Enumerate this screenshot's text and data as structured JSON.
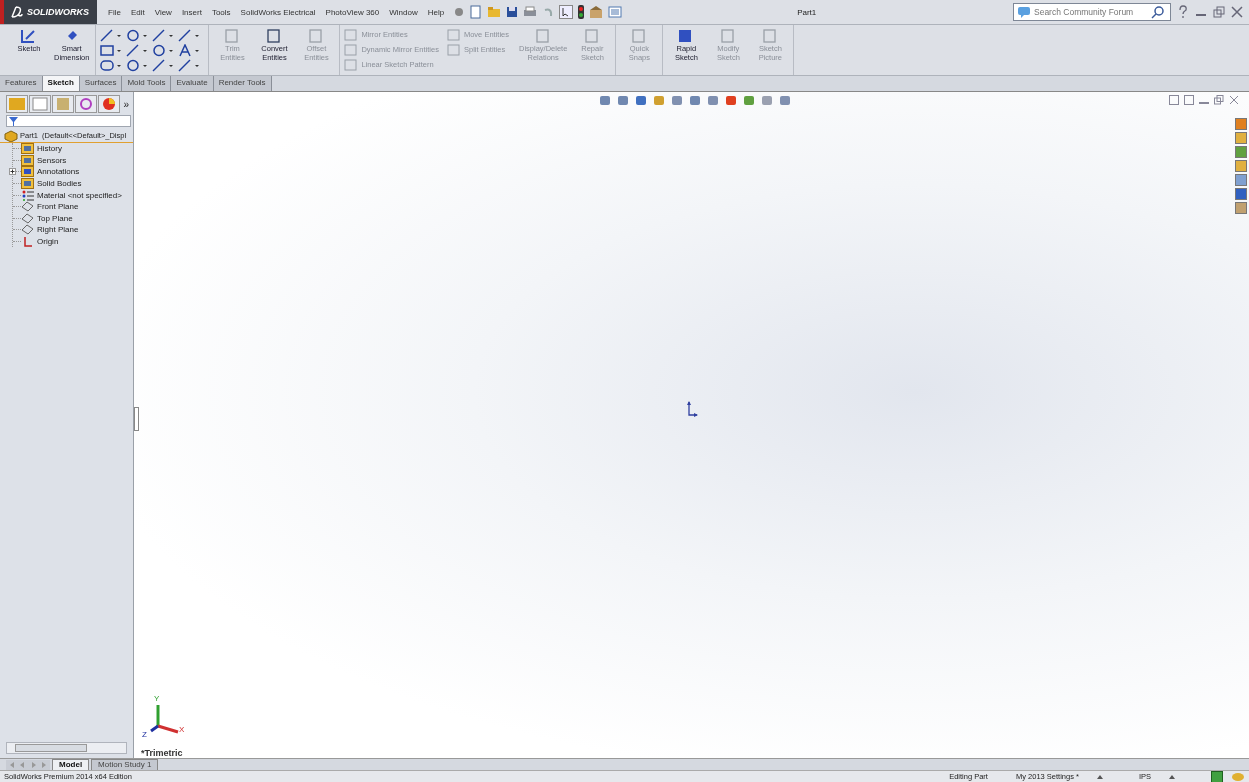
{
  "app": {
    "logo": "SOLIDWORKS",
    "title": "Part1"
  },
  "menu": [
    "File",
    "Edit",
    "View",
    "Insert",
    "Tools",
    "SolidWorks Electrical",
    "PhotoView 360",
    "Window",
    "Help"
  ],
  "search": {
    "placeholder": "Search Community Forum"
  },
  "ribbon": {
    "groups": [
      {
        "kind": "large",
        "items": [
          {
            "label": "Sketch",
            "disabled": false
          },
          {
            "label": "Smart Dimension",
            "disabled": false
          }
        ]
      },
      {
        "kind": "grid"
      },
      {
        "kind": "large",
        "items": [
          {
            "label": "Trim Entities",
            "disabled": true
          },
          {
            "label": "Convert Entities",
            "disabled": false
          },
          {
            "label": "Offset Entities",
            "disabled": true
          }
        ]
      },
      {
        "kind": "small",
        "items": [
          {
            "label": "Mirror Entities",
            "disabled": true
          },
          {
            "label": "Dynamic Mirror Entities",
            "disabled": true
          },
          {
            "label": "Linear Sketch Pattern",
            "disabled": true
          }
        ]
      },
      {
        "kind": "small",
        "items": [
          {
            "label": "Move Entities",
            "disabled": true
          },
          {
            "label": "Split Entities",
            "disabled": true
          }
        ]
      },
      {
        "kind": "large",
        "items": [
          {
            "label": "Display/Delete Relations",
            "disabled": true
          },
          {
            "label": "Repair Sketch",
            "disabled": true
          }
        ]
      },
      {
        "kind": "large",
        "items": [
          {
            "label": "Quick Snaps",
            "disabled": true
          }
        ]
      },
      {
        "kind": "large",
        "items": [
          {
            "label": "Rapid Sketch",
            "disabled": false
          },
          {
            "label": "Modify Sketch",
            "disabled": true
          },
          {
            "label": "Sketch Picture",
            "disabled": true
          }
        ]
      }
    ]
  },
  "tabs": [
    {
      "label": "Features",
      "selected": false
    },
    {
      "label": "Sketch",
      "selected": true
    },
    {
      "label": "Surfaces",
      "selected": false
    },
    {
      "label": "Mold Tools",
      "selected": false
    },
    {
      "label": "Evaluate",
      "selected": false
    },
    {
      "label": "Render Tools",
      "selected": false
    }
  ],
  "panel": {
    "more": "»",
    "tree": {
      "label": "Part1  (Default<<Default>_Displ",
      "kind": "part",
      "children": [
        {
          "label": "History",
          "kind": "folder"
        },
        {
          "label": "Sensors",
          "kind": "folder"
        },
        {
          "label": "Annotations",
          "kind": "annotation",
          "expanded": false
        },
        {
          "label": "Solid Bodies",
          "kind": "folder"
        },
        {
          "label": "Material <not specified>",
          "kind": "material"
        },
        {
          "label": "Front Plane",
          "kind": "plane"
        },
        {
          "label": "Top Plane",
          "kind": "plane"
        },
        {
          "label": "Right Plane",
          "kind": "plane"
        },
        {
          "label": "Origin",
          "kind": "origin"
        }
      ]
    }
  },
  "viewport": {
    "view_label": "*Trimetric",
    "axes": [
      "Y",
      "X",
      "Z"
    ]
  },
  "bottom_tabs": [
    {
      "label": "Model",
      "selected": true
    },
    {
      "label": "Motion Study 1",
      "selected": false
    }
  ],
  "status_bar": {
    "product": "SolidWorks Premium 2014 x64 Edition",
    "mode": "Editing Part",
    "settings": "My 2013 Settings *",
    "units": "IPS"
  }
}
